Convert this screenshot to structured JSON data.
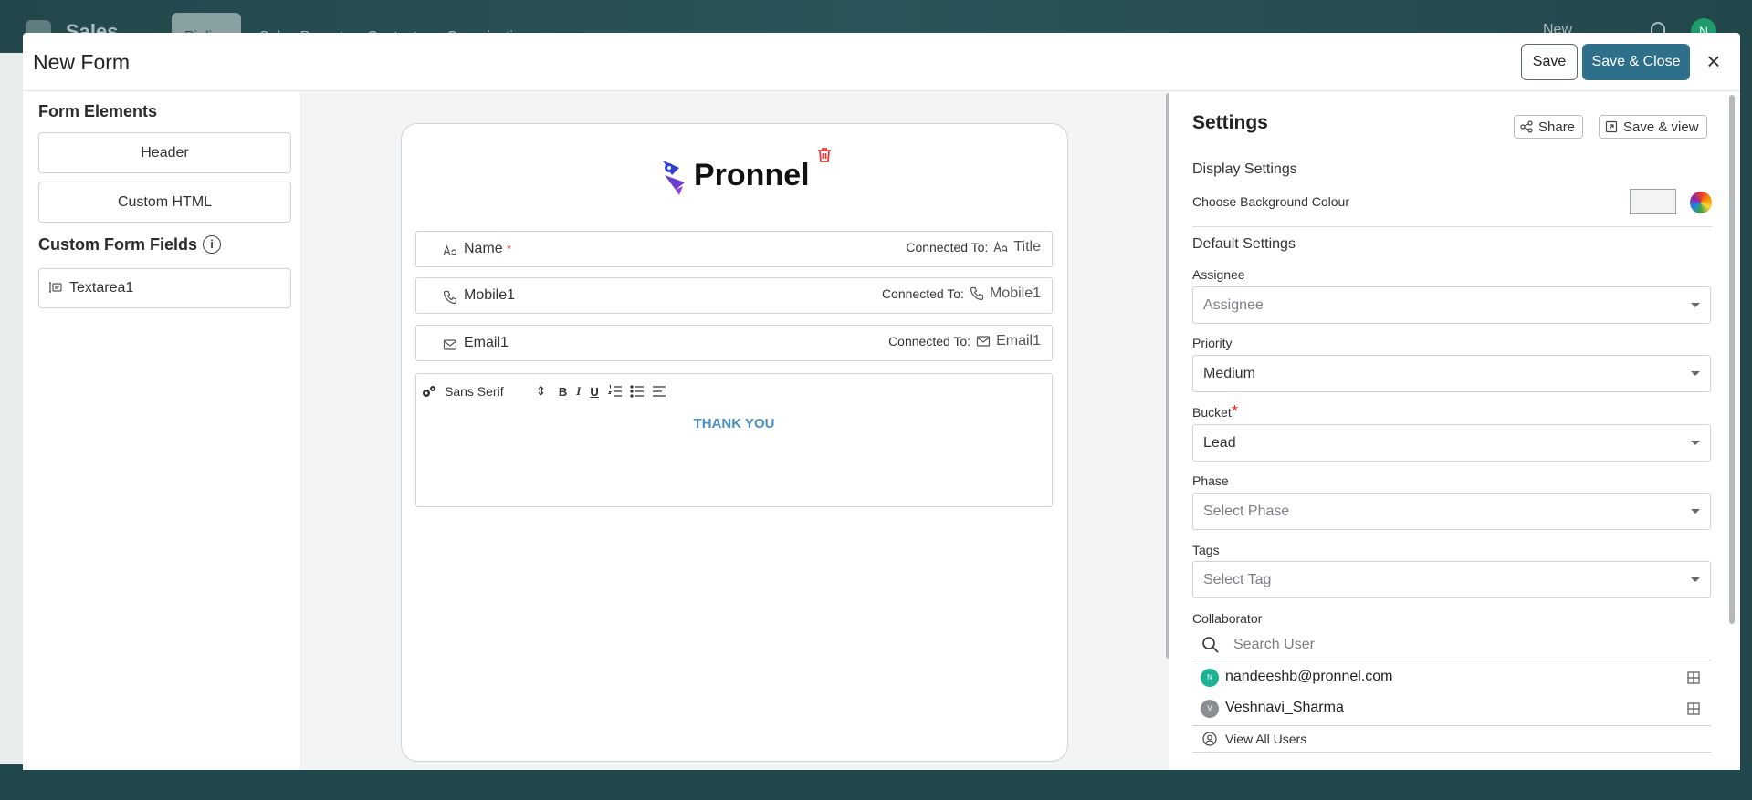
{
  "background": {
    "app_title": "Sales",
    "tabs": [
      "Pipline",
      "Sales Report",
      "Contact",
      "Organization"
    ],
    "new_label": "New",
    "avatar_letter": "N"
  },
  "modal": {
    "title": "New Form",
    "save_label": "Save",
    "save_close_label": "Save & Close",
    "close_icon": "×"
  },
  "left": {
    "form_elements_title": "Form Elements",
    "header_btn": "Header",
    "custom_html_btn": "Custom HTML",
    "custom_fields_title": "Custom Form Fields",
    "info_glyph": "i",
    "fields": [
      "Textarea1"
    ]
  },
  "form": {
    "logo_text": "Pronnel",
    "connected_label": "Connected To:",
    "rows": [
      {
        "label": "Name",
        "required": "*",
        "connected": "Title"
      },
      {
        "label": "Mobile1",
        "required": "",
        "connected": "Mobile1"
      },
      {
        "label": "Email1",
        "required": "",
        "connected": "Email1"
      }
    ],
    "editor": {
      "font": "Sans Serif",
      "bold": "B",
      "italic": "I",
      "underline": "U",
      "thank_you": "THANK YOU"
    }
  },
  "settings": {
    "title": "Settings",
    "share_label": "Share",
    "save_view_label": "Save & view",
    "display_settings": "Display Settings",
    "choose_bg": "Choose Background Colour",
    "bg_color": "#f2f3f3",
    "default_settings": "Default Settings",
    "assignee_label": "Assignee",
    "assignee_placeholder": "Assignee",
    "priority_label": "Priority",
    "priority_value": "Medium",
    "bucket_label": "Bucket",
    "bucket_required": "*",
    "bucket_value": "Lead",
    "phase_label": "Phase",
    "phase_placeholder": "Select Phase",
    "tags_label": "Tags",
    "tags_placeholder": "Select Tag",
    "collaborator_label": "Collaborator",
    "search_placeholder": "Search User",
    "users": [
      {
        "initial": "N",
        "name": "nandeeshb@pronnel.com",
        "color": "#1bb394"
      },
      {
        "initial": "V",
        "name": "Veshnavi_Sharma",
        "color": "#8a8f93"
      }
    ],
    "view_all": "View All Users"
  },
  "colors": {
    "primary": "#2e7089",
    "accent_blue": "#4a8fc4",
    "danger": "#e22222"
  }
}
